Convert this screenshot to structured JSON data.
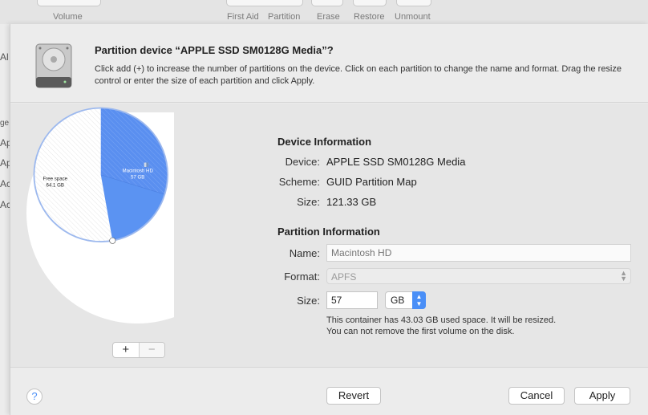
{
  "toolbar": {
    "items": [
      {
        "label": "Volume"
      },
      {
        "label": "First Aid"
      },
      {
        "label": "Partition"
      },
      {
        "label": "Erase"
      },
      {
        "label": "Restore"
      },
      {
        "label": "Unmount"
      }
    ]
  },
  "background_sidebar": [
    "Al",
    "ge",
    "Ap",
    "Ap",
    "Ac",
    "Ac"
  ],
  "sheet": {
    "title": "Partition device “APPLE SSD SM0128G Media”?",
    "description": "Click add (+) to increase the number of partitions on the device. Click on each partition to change the name and format. Drag the resize control or enter the size of each partition and click Apply."
  },
  "pie": {
    "free_space": {
      "label": "Free space",
      "size": "64.1 GB",
      "color": "#ffffff"
    },
    "macintosh_hd": {
      "label": "Macintosh HD",
      "size": "57 GB",
      "color": "#5b93f2"
    },
    "free_fraction": 0.528,
    "used_fraction_within_partition": 0.755
  },
  "add_button": "+",
  "remove_button": "−",
  "device_info": {
    "heading": "Device Information",
    "device_label": "Device:",
    "device_value": "APPLE SSD SM0128G Media",
    "scheme_label": "Scheme:",
    "scheme_value": "GUID Partition Map",
    "size_label": "Size:",
    "size_value": "121.33 GB"
  },
  "partition_info": {
    "heading": "Partition Information",
    "name_label": "Name:",
    "name_placeholder": "Macintosh HD",
    "format_label": "Format:",
    "format_value": "APFS",
    "size_label": "Size:",
    "size_value": "57",
    "size_unit": "GB",
    "note_line1": "This container has 43.03 GB used space. It will be resized.",
    "note_line2": "You can not remove the first volume on the disk."
  },
  "footer": {
    "help": "?",
    "revert": "Revert",
    "cancel": "Cancel",
    "apply": "Apply"
  },
  "colors": {
    "accent": "#4a8ff7",
    "partition_blue": "#5b93f2"
  }
}
